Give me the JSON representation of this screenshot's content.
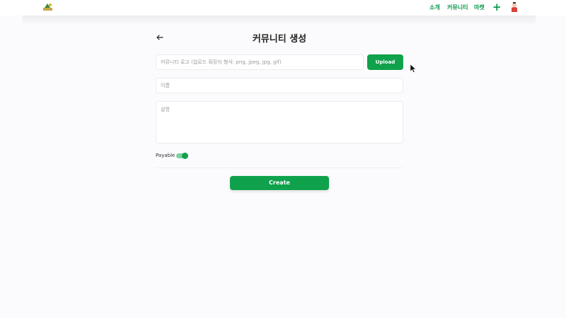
{
  "nav": {
    "items": [
      "소개",
      "커뮤니티",
      "마켓"
    ],
    "add_icon": "plus-icon",
    "avatar_icon": "avatar-icon",
    "logo_icon": "logo-icon"
  },
  "page": {
    "title": "커뮤니티 생성",
    "back_icon": "arrow-left-icon"
  },
  "form": {
    "logo_placeholder": "커뮤니티 로고 (업로드 확장자 형식: png, jpeg, jpg, gif)",
    "upload_label": "Upload",
    "name_placeholder": "이름",
    "description_placeholder": "설명",
    "payable_label": "Payable",
    "payable_on": true,
    "create_label": "Create"
  },
  "colors": {
    "accent": "#10a14c",
    "nav_text": "#0a9a4a"
  }
}
